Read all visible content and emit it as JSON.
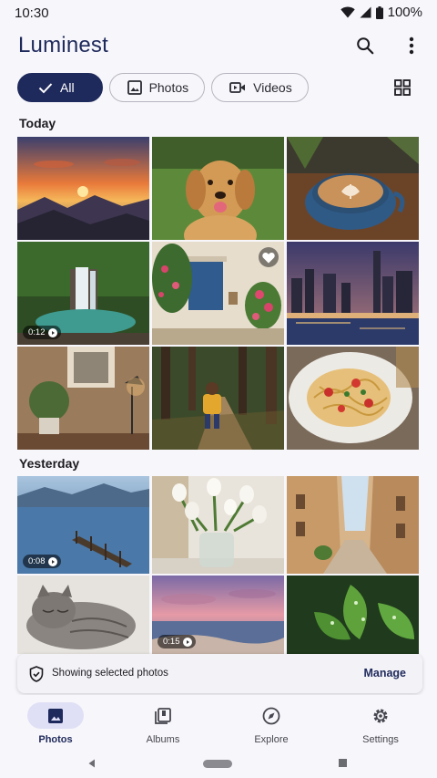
{
  "status_bar": {
    "time": "10:30",
    "battery": "100%"
  },
  "app": {
    "title": "Luminest",
    "search_icon": "search-icon",
    "menu_icon": "more-vert-icon"
  },
  "filters": {
    "chips": [
      {
        "label": "All",
        "selected": true,
        "icon": "check-icon"
      },
      {
        "label": "Photos",
        "selected": false,
        "icon": "image-icon"
      },
      {
        "label": "Videos",
        "selected": false,
        "icon": "video-icon"
      }
    ],
    "grid_icon": "grid-view-icon"
  },
  "sections": [
    {
      "title": "Today",
      "photos": [
        {
          "subject": "sunset-over-mountains"
        },
        {
          "subject": "golden-retriever"
        },
        {
          "subject": "latte-art-coffee"
        },
        {
          "subject": "waterfall-video",
          "duration": "0:12"
        },
        {
          "subject": "flower-doorway",
          "favorite": true
        },
        {
          "subject": "city-skyline-night"
        },
        {
          "subject": "living-room-lamp"
        },
        {
          "subject": "child-forest-path"
        },
        {
          "subject": "pasta-dish"
        }
      ]
    },
    {
      "title": "Yesterday",
      "photos": [
        {
          "subject": "lake-pier-video",
          "duration": "0:08"
        },
        {
          "subject": "white-tulips"
        },
        {
          "subject": "old-town-street"
        },
        {
          "subject": "sleeping-cat"
        },
        {
          "subject": "beach-sunset-video",
          "duration": "0:15"
        },
        {
          "subject": "green-leaves-dew"
        }
      ]
    }
  ],
  "snackbar": {
    "message": "Showing selected photos",
    "action": "Manage",
    "icon": "shield-icon"
  },
  "bottom_nav": {
    "items": [
      {
        "label": "Photos",
        "icon": "photo-icon",
        "active": true
      },
      {
        "label": "Albums",
        "icon": "albums-icon",
        "active": false
      },
      {
        "label": "Explore",
        "icon": "explore-icon",
        "active": false
      },
      {
        "label": "Settings",
        "icon": "settings-icon",
        "active": false
      }
    ]
  },
  "colors": {
    "primary": "#1f2a5c",
    "background": "#f7f6fa",
    "nav_active_pill": "#dfe0f6"
  }
}
